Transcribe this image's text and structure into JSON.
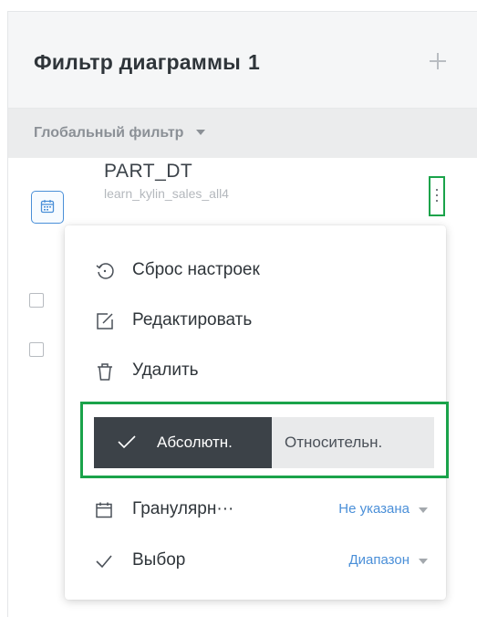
{
  "header": {
    "title": "Фильтр диаграммы",
    "count": "1"
  },
  "global_filter": {
    "label": "Глобальный фильтр"
  },
  "field": {
    "name": "PART_DT",
    "table": "learn_kylin_sales_all4"
  },
  "menu": {
    "items": [
      {
        "label": "Сброс настроек",
        "icon": "reset-icon"
      },
      {
        "label": "Редактировать",
        "icon": "edit-icon"
      },
      {
        "label": "Удалить",
        "icon": "trash-icon"
      }
    ],
    "segment": {
      "absolute": "Абсолютн.",
      "relative": "Относительн.",
      "selected": "absolute"
    },
    "options": [
      {
        "label": "Гранулярн···",
        "value": "Не указана",
        "icon": "calendar-icon"
      },
      {
        "label": "Выбор",
        "value": "Диапазон",
        "icon": "check-icon"
      }
    ]
  },
  "colors": {
    "accent": "#4a8fd8",
    "highlight": "#1aa34a",
    "dark": "#3c4248"
  }
}
